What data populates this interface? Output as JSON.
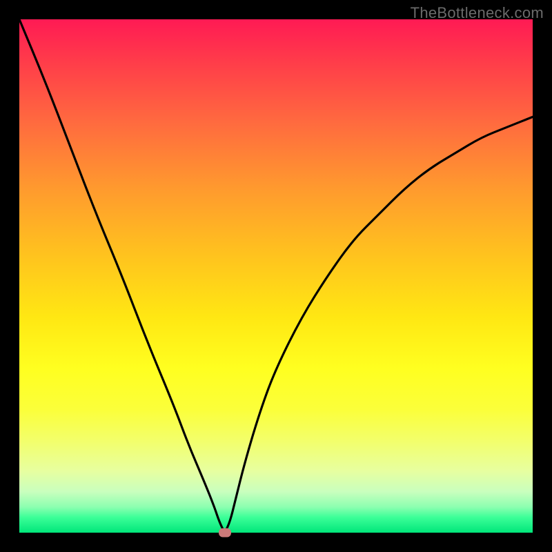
{
  "watermark": "TheBottleneck.com",
  "colors": {
    "frame": "#000000",
    "curve": "#000000",
    "marker": "#cc7a7a"
  },
  "chart_data": {
    "type": "line",
    "title": "",
    "xlabel": "",
    "ylabel": "",
    "xlim": [
      0,
      100
    ],
    "ylim": [
      0,
      100
    ],
    "grid": false,
    "legend": false,
    "series": [
      {
        "name": "bottleneck-curve",
        "x": [
          0,
          5,
          10,
          15,
          20,
          25,
          30,
          33,
          36,
          38,
          39,
          40,
          41,
          42,
          44,
          47,
          50,
          55,
          60,
          65,
          70,
          75,
          80,
          85,
          90,
          95,
          100
        ],
        "y": [
          100,
          88,
          75,
          62,
          50,
          37,
          25,
          17,
          10,
          5,
          2,
          0,
          2,
          6,
          14,
          24,
          32,
          42,
          50,
          57,
          62,
          67,
          71,
          74,
          77,
          79,
          81
        ]
      }
    ],
    "annotations": [
      {
        "name": "minimum-marker",
        "x": 40,
        "y": 0
      }
    ],
    "gradient_stops": [
      {
        "pos": 0.0,
        "color": "#ff1a54"
      },
      {
        "pos": 0.5,
        "color": "#ffd21e"
      },
      {
        "pos": 0.8,
        "color": "#ffff30"
      },
      {
        "pos": 1.0,
        "color": "#00e67a"
      }
    ]
  }
}
